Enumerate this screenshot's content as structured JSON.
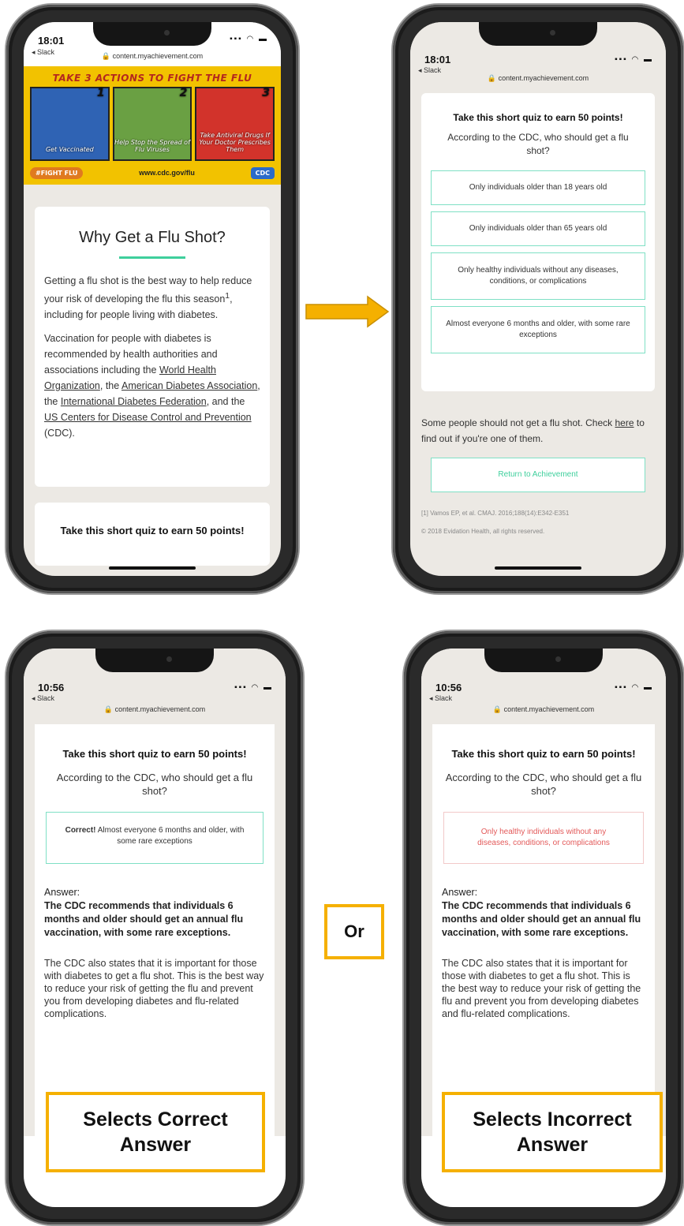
{
  "phone1": {
    "status": {
      "time": "18:01",
      "back": "◂ Slack",
      "url": "🔒 content.myachievement.com"
    },
    "poster": {
      "title": "TAKE 3 ACTIONS TO FIGHT THE FLU",
      "panels": [
        {
          "num": "1",
          "text": "Get Vaccinated",
          "color": "#2f63b4"
        },
        {
          "num": "2",
          "text": "Help Stop the Spread of Flu Viruses",
          "color": "#6aa043"
        },
        {
          "num": "3",
          "text": "Take Antiviral Drugs If Your Doctor Prescribes Them",
          "color": "#d2332b"
        }
      ],
      "hashtag": "#FIGHT FLU",
      "site": "www.cdc.gov/flu",
      "cdc": "CDC"
    },
    "why": {
      "title": "Why Get a Flu Shot?",
      "p1_a": "Getting a flu shot is the best way to help reduce your risk of developing the flu this season",
      "p1_sup": "1",
      "p1_b": ", including for people living with diabetes.",
      "p2_a": "Vaccination for people with diabetes is recommended by health authorities and associations including the ",
      "link_who": "World Health Organization",
      "p2_b": ", the ",
      "link_ada": "American Diabetes Association",
      "p2_c": ", the ",
      "link_idf": "International Diabetes Federation",
      "p2_d": ", and the ",
      "link_cdc": "US Centers for Disease Control and Prevention",
      "p2_e": " (CDC)."
    },
    "quiz_title": "Take this short quiz to earn 50 points!"
  },
  "phone2": {
    "status": {
      "time": "18:01",
      "back": "◂ Slack",
      "url": "🔒 content.myachievement.com"
    },
    "quiz_title": "Take this short quiz to earn 50 points!",
    "question": "According to the CDC, who should get a flu shot?",
    "options": [
      "Only individuals older than 18 years old",
      "Only individuals older than 65 years old",
      "Only healthy individuals without any diseases, conditions, or complications",
      "Almost everyone 6 months and older, with some rare exceptions"
    ],
    "note_a": "Some people should not get a flu shot. Check ",
    "note_link": "here",
    "note_b": " to find out if you're one of them.",
    "return_btn": "Return to Achievement",
    "citation": "[1] Vamos EP, et al. CMAJ. 2016;188(14):E342-E351",
    "copyright": "© 2018 Evidation Health, all rights reserved."
  },
  "phone3": {
    "status": {
      "time": "10:56",
      "back": "◂ Slack",
      "url": "🔒 content.myachievement.com"
    },
    "quiz_title": "Take this short quiz to earn 50 points!",
    "question": "According to the CDC, who should get a flu shot?",
    "result_strong": "Correct!",
    "result_text": " Almost everyone 6 months and older, with some rare exceptions",
    "answer_label": "Answer:",
    "answer_bold": "The CDC recommends that individuals 6 months and older should get an annual flu vaccination, with some rare exceptions.",
    "paragraph": "The CDC also states that it is important for those with diabetes to get a flu shot. This is the best way to reduce your risk of getting the flu and prevent you from developing diabetes and flu-related complications.",
    "caption": "Selects Correct Answer"
  },
  "phone4": {
    "status": {
      "time": "10:56",
      "back": "◂ Slack",
      "url": "🔒 content.myachievement.com"
    },
    "quiz_title": "Take this short quiz to earn 50 points!",
    "question": "According to the CDC, who should get a flu shot?",
    "result_text": "Only healthy individuals without any diseases, conditions, or complications",
    "answer_label": "Answer:",
    "answer_bold": "The CDC recommends that individuals 6 months and older should get an annual flu vaccination, with some rare exceptions.",
    "paragraph": "The CDC also states that it is important for those with diabetes to get a flu shot. This is the best way to reduce your risk of getting the flu and prevent you from developing diabetes and flu-related complications.",
    "caption": "Selects Incorrect Answer"
  },
  "or_label": "Or",
  "colors": {
    "accent_green": "#3ecf9c",
    "highlight_orange": "#f5b000",
    "wrong_red": "#e35a5a"
  }
}
